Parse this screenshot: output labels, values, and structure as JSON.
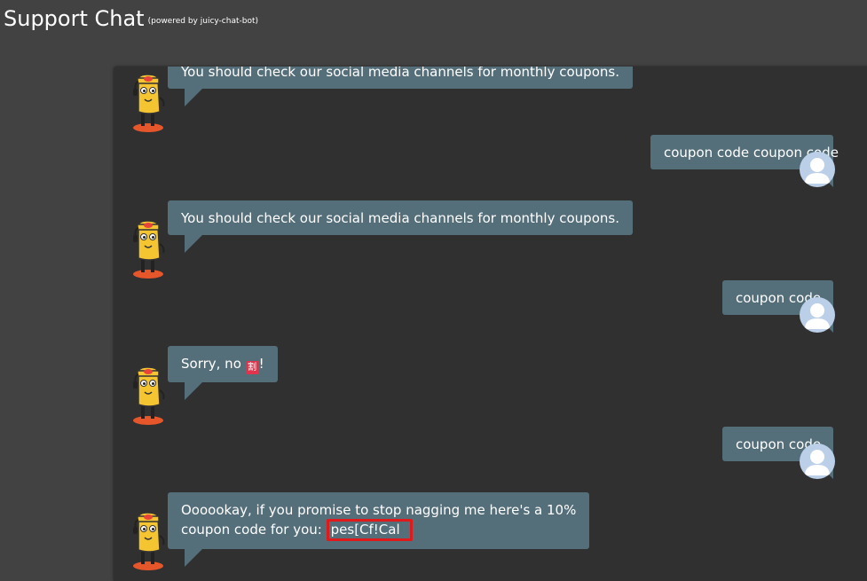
{
  "header": {
    "title": "Support Chat",
    "powered_by": "(powered by juicy-chat-bot)"
  },
  "messages": [
    {
      "from": "bot",
      "text": "You should check our social media channels for monthly coupons."
    },
    {
      "from": "user",
      "text": "coupon code coupon code"
    },
    {
      "from": "bot",
      "text": "You should check our social media channels for monthly coupons."
    },
    {
      "from": "user",
      "text": "coupon code"
    },
    {
      "from": "bot",
      "text_before": "Sorry, no ",
      "emoji": "割",
      "text_after": "!"
    },
    {
      "from": "user",
      "text": "coupon code"
    },
    {
      "from": "bot",
      "line1": "Oooookay, if you promise to stop nagging me here's a 10%",
      "line2_prefix": "coupon code for you: ",
      "coupon": "pes[Cf!Cal"
    }
  ],
  "colors": {
    "background": "#424242",
    "panel": "#303030",
    "bubble": "#546e7a",
    "highlight": "#e0191b"
  }
}
